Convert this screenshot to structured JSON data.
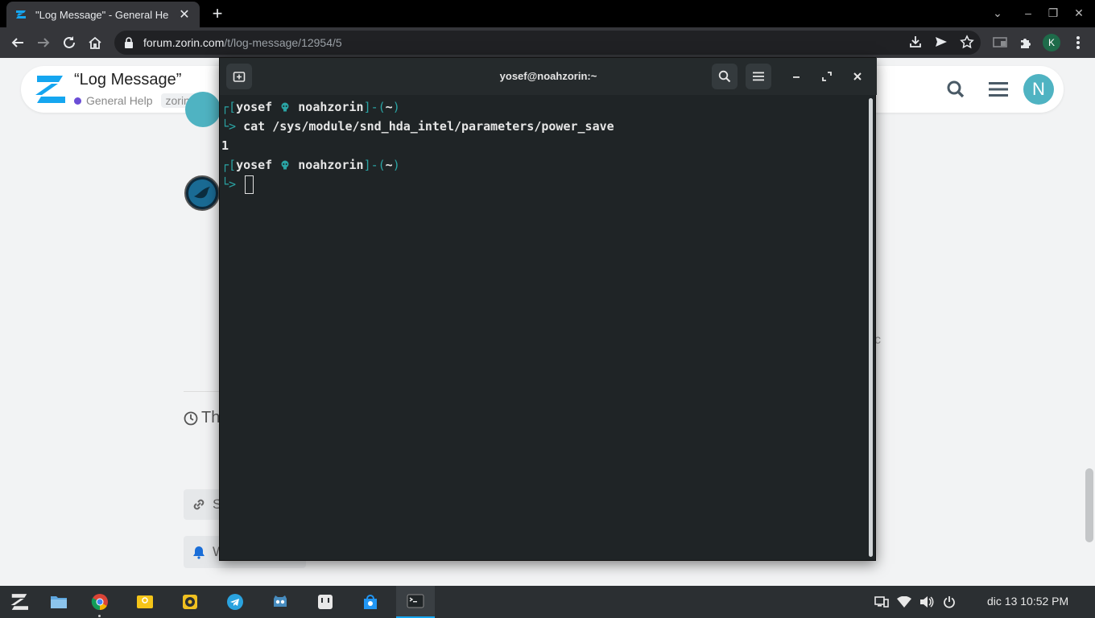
{
  "browser": {
    "tab_title": "\"Log Message\" - General He",
    "url_host": "forum.zorin.com",
    "url_path": "/t/log-message/12954/5",
    "profile_initial": "K"
  },
  "forum": {
    "topic_title": "“Log Message”",
    "category": "General Help",
    "tag": "zorin-os",
    "user_avatar_initial": "N",
    "frag_c": "c",
    "timer_text": "Th",
    "share_text": "S",
    "watch_text": "W"
  },
  "terminal": {
    "title": "yosef@noahzorin:~",
    "lines": {
      "p1_user": "yosef",
      "p1_host": "noahzorin",
      "p1_dir": "~",
      "cmd": "cat /sys/module/snd_hda_intel/parameters/power_save",
      "output": "1",
      "p2_user": "yosef",
      "p2_host": "noahzorin",
      "p2_dir": "~"
    }
  },
  "taskbar": {
    "clock": "dic 13  10:52 PM"
  },
  "colors": {
    "terminal_bg": "#1f2426",
    "prompt_cyan": "#2aa4a4",
    "zorin_blue": "#15a6f0",
    "avatar_teal": "#4fb3c2",
    "category_purple": "#6b4ed6"
  }
}
